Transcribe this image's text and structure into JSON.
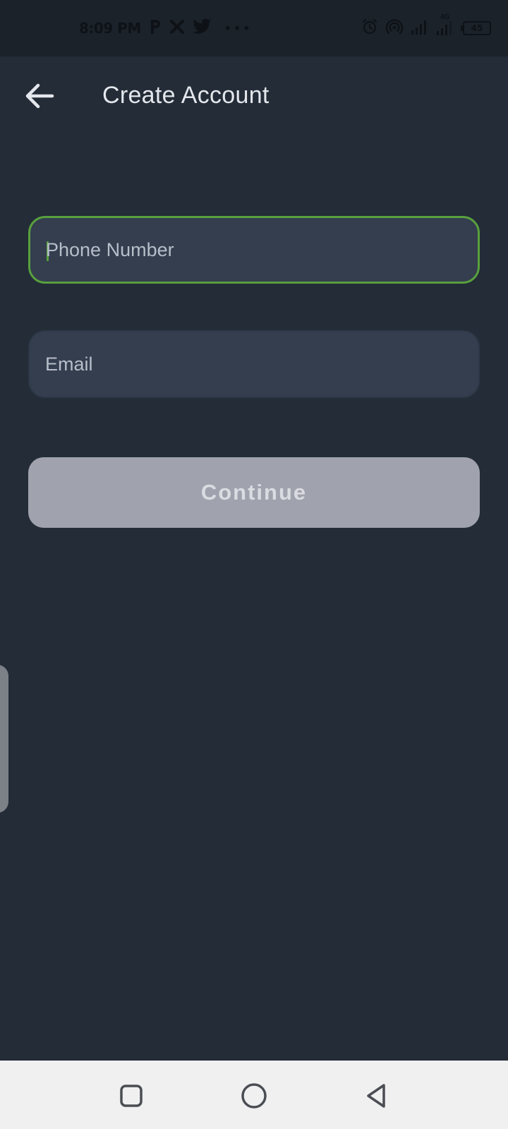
{
  "status_bar": {
    "time": "8:09 PM",
    "notification_icons": [
      "p-icon",
      "x-icon",
      "twitter-bird-icon"
    ],
    "more_dots": "•••",
    "right_icons": [
      "alarm-icon",
      "hotspot-icon",
      "signal-icon",
      "signal-4g-icon"
    ],
    "network_label": "4G",
    "battery": "45"
  },
  "header": {
    "back_icon": "arrow-left-icon",
    "title": "Create Account"
  },
  "form": {
    "phone": {
      "placeholder": "Phone Number",
      "value": ""
    },
    "email": {
      "placeholder": "Email",
      "value": ""
    },
    "continue_label": "Continue"
  },
  "colors": {
    "background": "#232c37",
    "field_background": "#343e4f",
    "focus_accent": "#58a03e",
    "button_disabled": "#a0a2ad",
    "nav_bar": "#f0f0f1"
  },
  "nav_bar": {
    "buttons": [
      "recents-square-icon",
      "home-circle-icon",
      "back-triangle-icon"
    ]
  }
}
